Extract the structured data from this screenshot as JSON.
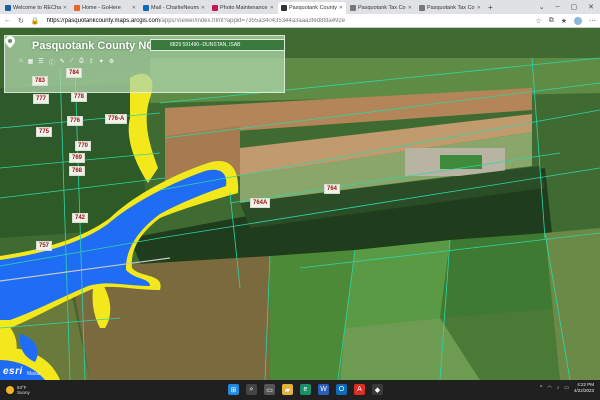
{
  "tabs": [
    {
      "title": "Welcome to REChat",
      "color": "#1b5fa7"
    },
    {
      "title": "Home - GoHere",
      "color": "#e8642c"
    },
    {
      "title": "Mail - CharlieNeuma",
      "color": "#0f6cbd"
    },
    {
      "title": "Photo Maintenance",
      "color": "#c2185b"
    },
    {
      "title": "Pasquotank County",
      "color": "#333333",
      "active": true
    },
    {
      "title": "Pasquotank Tax Co",
      "color": "#777777"
    },
    {
      "title": "Pasquotank Tax Co",
      "color": "#777777"
    }
  ],
  "address": {
    "host": "https://pasquotankcounty.maps.arcgis.com",
    "path": "/apps/Viewer/index.html?appid=7355a340435344a3aaa3fed8fda492e"
  },
  "app": {
    "title": "Pasquotank County NC",
    "search_value": "8829  591490--DUNSTAN, ISAB"
  },
  "parcels": [
    "783",
    "784",
    "777",
    "778",
    "776",
    "776-A",
    "775",
    "770",
    "769",
    "768",
    "742",
    "764",
    "764A",
    "757"
  ],
  "attribution": {
    "logo": "esri",
    "source": "Maxar"
  },
  "weather": {
    "temp": "63°F",
    "cond": "Sunny"
  },
  "clock": {
    "time": "4:22 PM",
    "date": "4/22/2023"
  },
  "colors": {
    "flood_zone": "#1f6cf5",
    "flood_edge": "#f2e81c",
    "parcel_line": "#2fd6a7"
  }
}
